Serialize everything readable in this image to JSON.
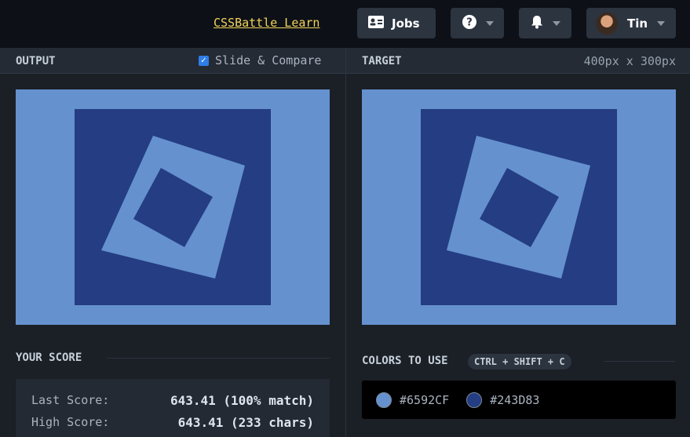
{
  "topbar": {
    "learn_link": "CSSBattle Learn",
    "jobs_label": "Jobs",
    "user_name": "Tin"
  },
  "output_panel": {
    "title": "OUTPUT",
    "slide_compare_label": "Slide & Compare",
    "slide_compare_checked": true
  },
  "target_panel": {
    "title": "TARGET",
    "dimensions": "400px x 300px"
  },
  "score": {
    "title": "YOUR SCORE",
    "last_label": "Last Score:",
    "last_value": "643.41 (100% match)",
    "high_label": "High Score:",
    "high_value": "643.41 (233 chars)"
  },
  "colors": {
    "title": "COLORS TO USE",
    "shortcut": "CTRL + SHIFT + C",
    "list": [
      {
        "hex": "#6592CF",
        "label": "#6592CF"
      },
      {
        "hex": "#243D83",
        "label": "#243D83"
      }
    ]
  },
  "icons": [
    "id-card-icon",
    "help-circle-icon",
    "bell-icon",
    "caret-down-icon",
    "avatar",
    "checkbox-check-icon"
  ]
}
